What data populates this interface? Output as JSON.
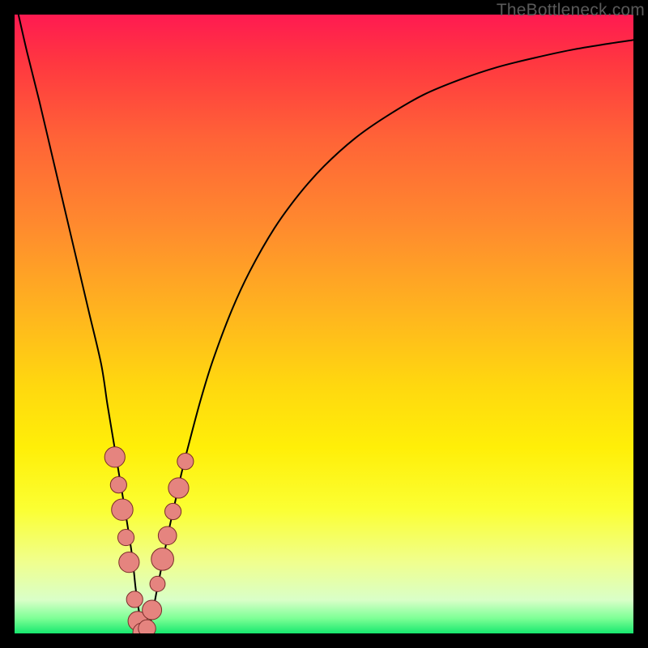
{
  "watermark": "TheBottleneck.com",
  "colors": {
    "frame": "#000000",
    "curve": "#000000",
    "marker_fill": "#e5847f",
    "marker_stroke": "#7a2c2a",
    "gradient_stops": [
      "#ff1a51",
      "#ff3840",
      "#ff6337",
      "#ff8a2e",
      "#ffb41f",
      "#ffd80f",
      "#ffef08",
      "#fbff33",
      "#f0ff8e",
      "#d9ffc8",
      "#7cff95",
      "#17e86e"
    ]
  },
  "chart_data": {
    "type": "line",
    "title": "",
    "xlabel": "",
    "ylabel": "",
    "xlim": [
      0,
      100
    ],
    "ylim": [
      0,
      100
    ],
    "x": [
      0.4,
      2,
      4,
      6,
      8,
      10,
      12,
      14,
      15,
      16,
      17,
      18,
      19,
      19.6,
      20.3,
      21,
      22,
      23,
      24,
      25,
      26,
      27,
      28,
      30,
      32,
      35,
      38,
      42,
      46,
      50,
      55,
      60,
      66,
      72,
      78,
      84,
      90,
      96,
      100
    ],
    "series": [
      {
        "name": "bottleneck-curve",
        "values": [
          101,
          94,
          86,
          77.5,
          69,
          60.5,
          52,
          43.5,
          37,
          31,
          25,
          19,
          12.5,
          7,
          2.5,
          0,
          2,
          7,
          12,
          17,
          21.5,
          26,
          30,
          37.5,
          44,
          52,
          58.5,
          65.5,
          71,
          75.5,
          80,
          83.5,
          87,
          89.5,
          91.5,
          93,
          94.3,
          95.3,
          95.9
        ]
      }
    ],
    "markers": {
      "name": "highlighted-points",
      "points": [
        {
          "x": 16.2,
          "y": 28.5,
          "r": 2.0
        },
        {
          "x": 16.8,
          "y": 24.0,
          "r": 1.6
        },
        {
          "x": 17.4,
          "y": 20.0,
          "r": 2.1
        },
        {
          "x": 18.0,
          "y": 15.5,
          "r": 1.6
        },
        {
          "x": 18.5,
          "y": 11.5,
          "r": 2.0
        },
        {
          "x": 19.4,
          "y": 5.5,
          "r": 1.6
        },
        {
          "x": 19.9,
          "y": 2.0,
          "r": 1.9
        },
        {
          "x": 20.6,
          "y": 0.2,
          "r": 1.8
        },
        {
          "x": 21.4,
          "y": 0.8,
          "r": 1.7
        },
        {
          "x": 22.2,
          "y": 3.8,
          "r": 1.9
        },
        {
          "x": 23.1,
          "y": 8.0,
          "r": 1.5
        },
        {
          "x": 23.9,
          "y": 12.0,
          "r": 2.2
        },
        {
          "x": 24.7,
          "y": 15.8,
          "r": 1.8
        },
        {
          "x": 25.6,
          "y": 19.7,
          "r": 1.6
        },
        {
          "x": 26.5,
          "y": 23.5,
          "r": 2.0
        },
        {
          "x": 27.6,
          "y": 27.8,
          "r": 1.6
        }
      ]
    }
  }
}
